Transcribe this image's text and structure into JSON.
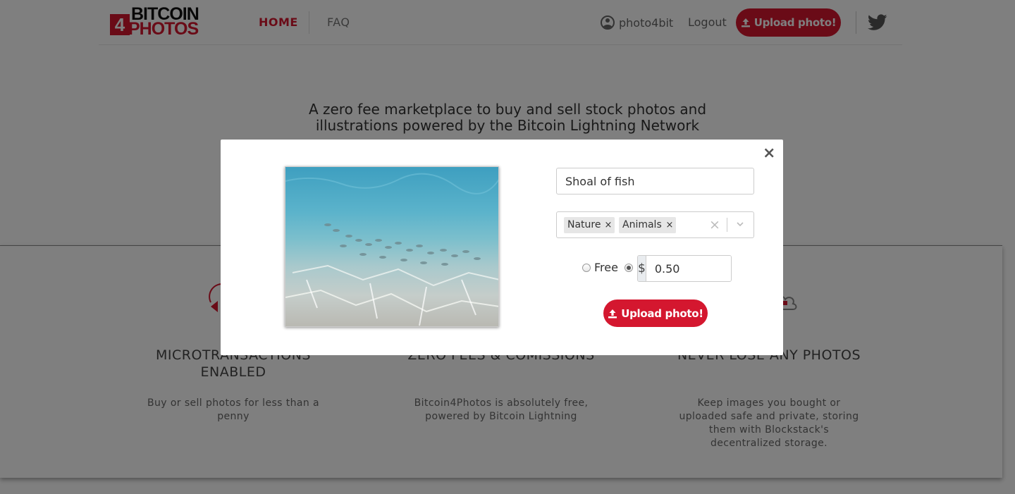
{
  "brand": {
    "logo_mark": "4",
    "logo_line1": "BITCOIN",
    "logo_line2": "PHOTOS",
    "accent_color": "#d4172f"
  },
  "nav": {
    "home": "HOME",
    "faq": "FAQ",
    "username": "photo4bit",
    "logout": "Logout",
    "upload": "Upload photo!",
    "user_icon": "user-circle-icon",
    "twitter_icon": "twitter-icon"
  },
  "hero": {
    "tagline": "A zero fee marketplace to buy and sell stock photos and illustrations powered by the Bitcoin Lightning Network"
  },
  "features": [
    {
      "title": "MICROTRANSACTIONS ENABLED",
      "description": "Buy or sell photos for less than a penny",
      "icon": "lightning-coin-icon"
    },
    {
      "title": "ZERO FEES & COMISSIONS",
      "description": "Bitcoin4Photos is absolutely free, powered by Bitcoin Lightning",
      "icon": "percent-icon"
    },
    {
      "title": "NEVER LOSE ANY PHOTOS",
      "description": "Keep images you bought or uploaded safe and private, storing them with Blockstack's decentralized storage.",
      "icon": "cloud-icon"
    }
  ],
  "modal": {
    "close_label": "×",
    "photo_alt": "underwater-fish-photo",
    "title_value": "Shoal of fish",
    "tags": [
      {
        "label": "Nature",
        "remove": "×"
      },
      {
        "label": "Animals",
        "remove": "×"
      }
    ],
    "tags_clear": "×",
    "price_type": "paid",
    "free_label": "Free",
    "currency_symbol": "$",
    "price_value": "0.50",
    "upload_label": "Upload photo!"
  }
}
